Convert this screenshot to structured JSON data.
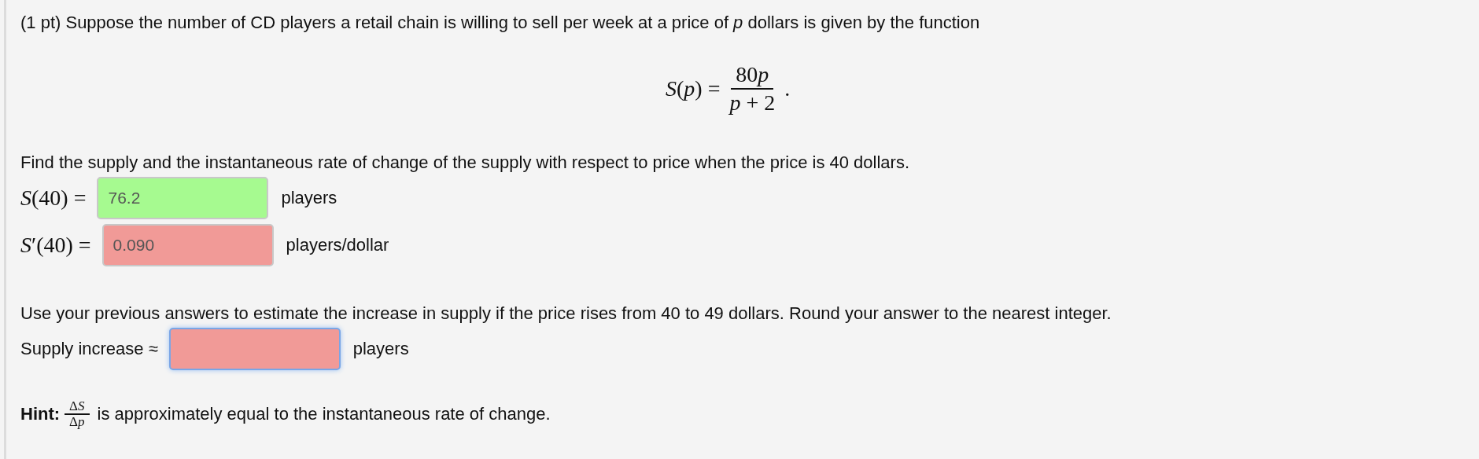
{
  "problem": {
    "intro": "(1 pt) Suppose the number of CD players a retail chain is willing to sell per week at a price of *p* dollars is given by the function",
    "formula": {
      "lhs": "*S*(*p*) =",
      "numerator": [
        {
          "kind": "number",
          "text": "80"
        },
        {
          "kind": "variable",
          "text": "p"
        }
      ],
      "denominator": "*p* + 2",
      "end": "."
    },
    "part_1": {
      "instruction": "Find the supply and the instantaneous rate of change of the supply with respect to price when the price is 40 dollars.",
      "answers": [
        {
          "label": "*S*(40) =",
          "value": "76.2",
          "correct": true,
          "focused": false,
          "unit": "players"
        },
        {
          "label": "*S*′(40) =",
          "value": "0.090",
          "correct": false,
          "focused": false,
          "unit": "players/dollar"
        }
      ]
    },
    "part_2": {
      "instruction": "Use your previous answers to estimate the increase in supply if the price rises from 40 to 49 dollars. Round your answer to the nearest integer.",
      "answers": [
        {
          "label": "Supply increase ≈",
          "correct": false,
          "focused": true,
          "unit": "players"
        }
      ]
    },
    "hint": {
      "label": "Hint:",
      "numerator": [
        {
          "kind": "symbol",
          "text": "Δ"
        },
        {
          "kind": "variable",
          "text": "S"
        }
      ],
      "denominator": [
        {
          "kind": "symbol",
          "text": "Δ"
        },
        {
          "kind": "variable",
          "text": "p"
        }
      ],
      "text": "is approximately equal to the instantaneous rate of change."
    }
  }
}
